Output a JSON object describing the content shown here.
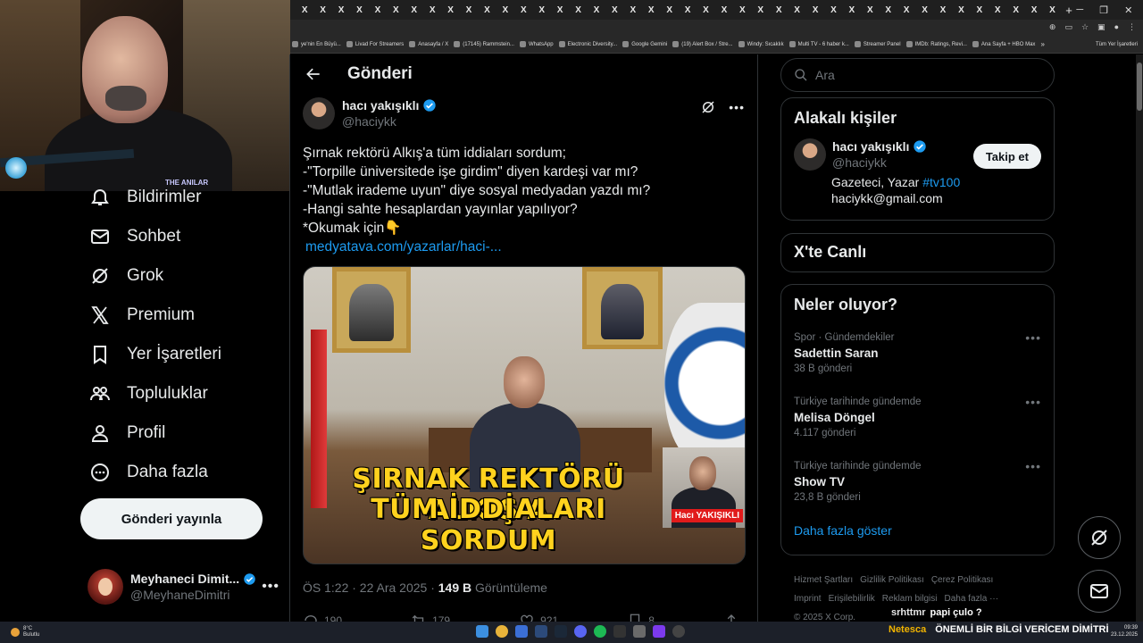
{
  "browser": {
    "tab_glyph": "X",
    "tab_count": 42,
    "new_tab": "+",
    "bookmarks": [
      "ye'nin En Büyü...",
      "Livad For Streamers",
      "Anasayfa / X",
      "(17145) Rammstein...",
      "WhatsApp",
      "Electronic Diversity...",
      "Google Gemini",
      "(19) Alert Box / Stre...",
      "Windy: Sıcaklık",
      "Multi TV - 6 haber k...",
      "Streamer Panel",
      "IMDb: Ratings, Revi...",
      "Ana Sayfa + HBO Max"
    ],
    "bookmarks_more": "»",
    "all_bookmarks": "Tüm Yer İşaretleri"
  },
  "webcam": {
    "logo_text": "THE ANILAR"
  },
  "left_nav": {
    "items": [
      {
        "label": "Bildirimler",
        "icon": "bell-icon"
      },
      {
        "label": "Sohbet",
        "icon": "mail-icon"
      },
      {
        "label": "Grok",
        "icon": "grok-icon"
      },
      {
        "label": "Premium",
        "icon": "x-logo-icon"
      },
      {
        "label": "Yer İşaretleri",
        "icon": "bookmark-icon"
      },
      {
        "label": "Topluluklar",
        "icon": "communities-icon"
      },
      {
        "label": "Profil",
        "icon": "person-icon"
      },
      {
        "label": "Daha fazla",
        "icon": "more-circle-icon"
      }
    ],
    "post_button": "Gönderi yayınla",
    "account": {
      "name": "Meyhaneci Dimit...",
      "handle": "@MeyhaneDimitri",
      "more": "•••"
    }
  },
  "center": {
    "title": "Gönderi",
    "tweet": {
      "author_name": "hacı yakışıklı",
      "author_handle": "@haciykk",
      "text_lines": [
        "Şırnak rektörü Alkış'a tüm iddiaları sordum;",
        "-\"Torpille üniversitede işe girdim\" diyen kardeşi var mı?",
        "-\"Mutlak irademe uyun\" diye sosyal medyadan yazdı mı?",
        "-Hangi sahte hesaplardan yayınlar yapılıyor?",
        "*Okumak için👇"
      ],
      "link": "medyatava.com/yazarlar/haci-...",
      "media": {
        "caption_line1": "ŞIRNAK REKTÖRÜ ALKIŞ'A",
        "caption_line2": "TÜM İDDİALARI SORDUM",
        "tag": "Hacı YAKIŞIKLI"
      },
      "timestamp": "ÖS 1:22 · 22 Ara 2025 · ",
      "views_count": "149 B",
      "views_label": " Görüntüleme",
      "stats": {
        "replies": "190",
        "reposts": "179",
        "likes": "921",
        "bookmarks": "8"
      }
    }
  },
  "right": {
    "search_placeholder": "Ara",
    "related": {
      "title": "Alakalı kişiler",
      "name": "hacı yakışıklı",
      "handle": "@haciykk",
      "follow": "Takip et",
      "bio_prefix": "Gazeteci, Yazar ",
      "bio_tag": "#tv100",
      "email": "haciykk@gmail.com"
    },
    "live_title": "X'te Canlı",
    "trends": {
      "title": "Neler oluyor?",
      "items": [
        {
          "context": "Spor · Gündemdekiler",
          "name": "Sadettin Saran",
          "count": "38 B gönderi"
        },
        {
          "context": "Türkiye tarihinde gündemde",
          "name": "Melisa Döngel",
          "count": "4.117 gönderi"
        },
        {
          "context": "Türkiye tarihinde gündemde",
          "name": "Show TV",
          "count": "23,8 B gönderi"
        }
      ],
      "show_more": "Daha fazla göster"
    },
    "footer": {
      "links": [
        "Hizmet Şartları",
        "Gizlilik Politikası",
        "Çerez Politikası",
        "Imprint",
        "Erişilebilirlik",
        "Reklam bilgisi",
        "Daha fazla ···"
      ],
      "copyright": "© 2025 X Corp."
    }
  },
  "chat": {
    "user": "srhttmr",
    "message": "papi çulo ?"
  },
  "ticker": {
    "name": "Netesca",
    "text": "ÖNEMLİ BİR BİLGİ VERİCEM DİMİTRİ"
  },
  "taskbar": {
    "weather_temp": "8°C",
    "weather_desc": "Bulutlu",
    "time": "09:39",
    "date": "23.12.2025"
  },
  "colors": {
    "accent": "#1d9bf0",
    "verified": "#1d9bf0",
    "caption": "#ffd21e",
    "ticker_name": "#f2b400"
  }
}
